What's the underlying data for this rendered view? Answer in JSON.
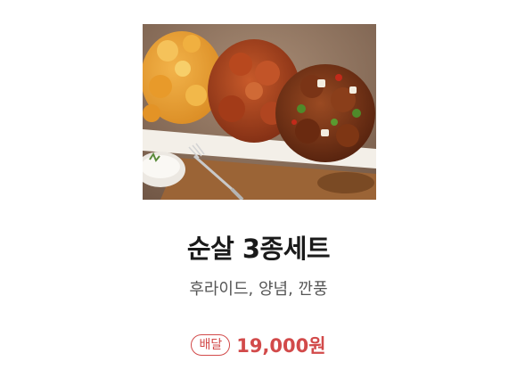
{
  "product": {
    "title": "순살 3종세트",
    "subtitle": "후라이드, 양념, 깐풍",
    "badge": "배달",
    "price": "19,000원",
    "image_icon": "fried-chicken-photo"
  },
  "colors": {
    "accent": "#d24a4a",
    "title": "#1a1a1a",
    "subtitle": "#555555"
  }
}
